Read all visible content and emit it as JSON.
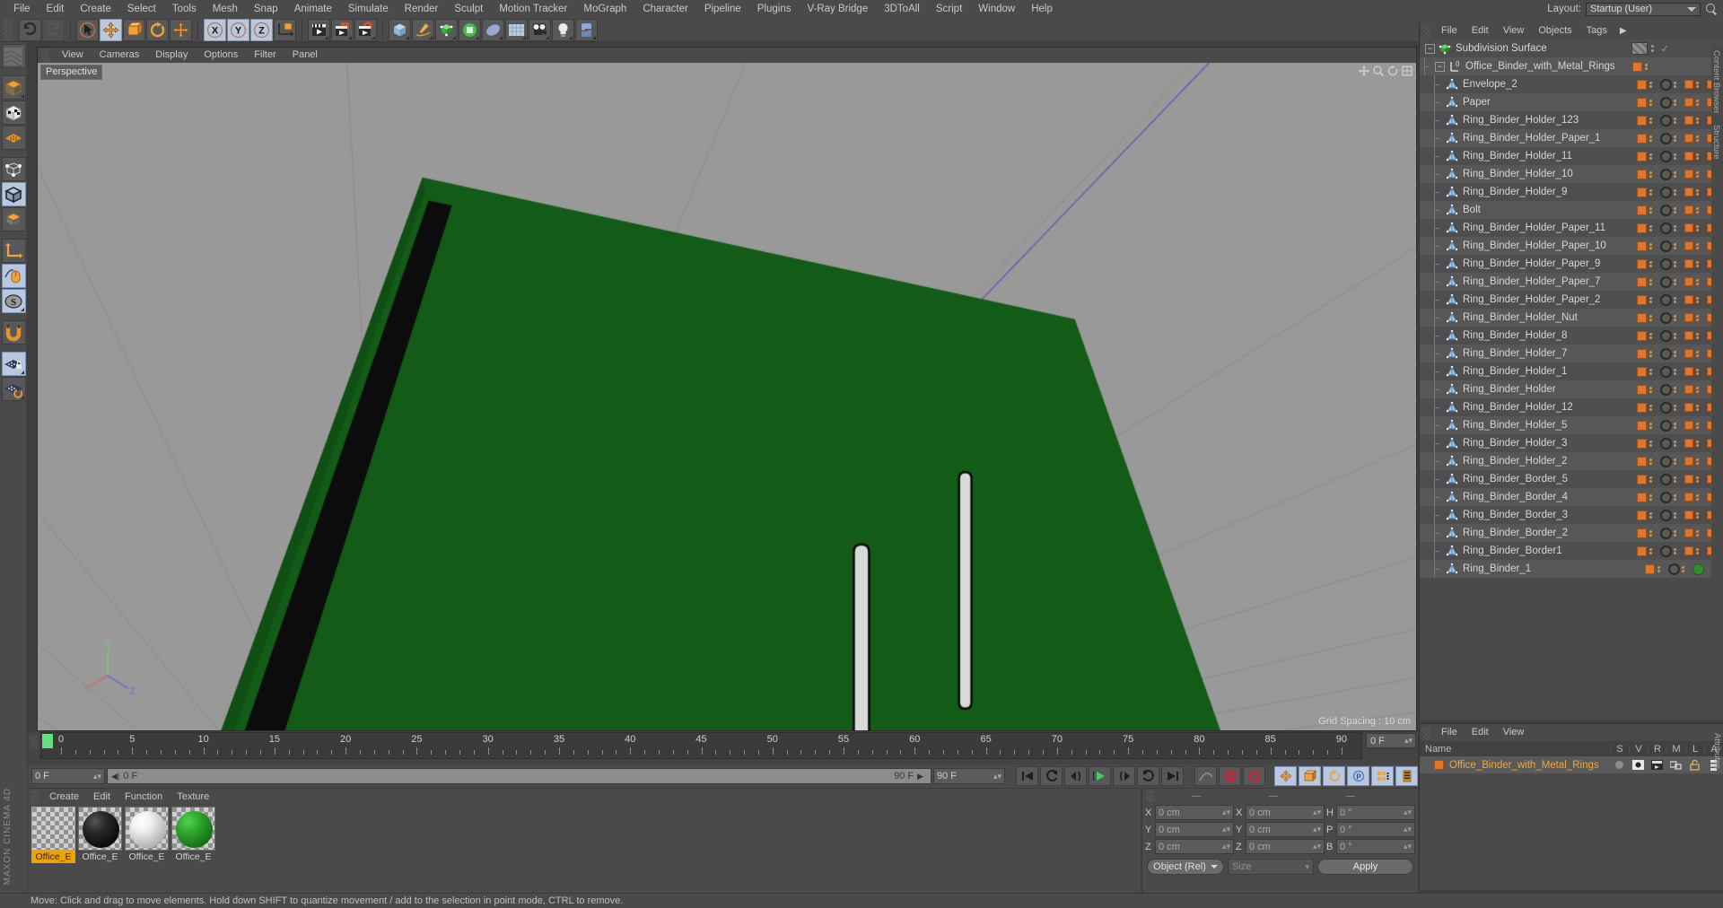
{
  "app": {
    "brand": "MAXON CINEMA 4D"
  },
  "menubar": {
    "items": [
      "File",
      "Edit",
      "Create",
      "Select",
      "Tools",
      "Mesh",
      "Snap",
      "Animate",
      "Simulate",
      "Render",
      "Sculpt",
      "Motion Tracker",
      "MoGraph",
      "Character",
      "Pipeline",
      "Plugins",
      "V-Ray Bridge",
      "3DToAll",
      "Script",
      "Window",
      "Help"
    ],
    "layout_label": "Layout:",
    "layout_value": "Startup (User)"
  },
  "viewport": {
    "menu": [
      "View",
      "Cameras",
      "Display",
      "Options",
      "Filter",
      "Panel"
    ],
    "camera_label": "Perspective",
    "grid_spacing": "Grid Spacing : 10 cm"
  },
  "object_manager": {
    "menu": [
      "File",
      "Edit",
      "View",
      "Objects",
      "Tags"
    ],
    "more": "▶",
    "items": [
      {
        "name": "Subdivision Surface",
        "depth": 0,
        "type": "generator"
      },
      {
        "name": "Office_Binder_with_Metal_Rings",
        "depth": 1,
        "type": "null"
      },
      {
        "name": "Envelope_2",
        "depth": 2,
        "type": "polygon"
      },
      {
        "name": "Paper",
        "depth": 2,
        "type": "polygon"
      },
      {
        "name": "Ring_Binder_Holder_123",
        "depth": 2,
        "type": "polygon"
      },
      {
        "name": "Ring_Binder_Holder_Paper_1",
        "depth": 2,
        "type": "polygon"
      },
      {
        "name": "Ring_Binder_Holder_11",
        "depth": 2,
        "type": "polygon"
      },
      {
        "name": "Ring_Binder_Holder_10",
        "depth": 2,
        "type": "polygon"
      },
      {
        "name": "Ring_Binder_Holder_9",
        "depth": 2,
        "type": "polygon"
      },
      {
        "name": "Bolt",
        "depth": 2,
        "type": "polygon"
      },
      {
        "name": "Ring_Binder_Holder_Paper_11",
        "depth": 2,
        "type": "polygon"
      },
      {
        "name": "Ring_Binder_Holder_Paper_10",
        "depth": 2,
        "type": "polygon"
      },
      {
        "name": "Ring_Binder_Holder_Paper_9",
        "depth": 2,
        "type": "polygon"
      },
      {
        "name": "Ring_Binder_Holder_Paper_7",
        "depth": 2,
        "type": "polygon"
      },
      {
        "name": "Ring_Binder_Holder_Paper_2",
        "depth": 2,
        "type": "polygon"
      },
      {
        "name": "Ring_Binder_Holder_Nut",
        "depth": 2,
        "type": "polygon"
      },
      {
        "name": "Ring_Binder_Holder_8",
        "depth": 2,
        "type": "polygon"
      },
      {
        "name": "Ring_Binder_Holder_7",
        "depth": 2,
        "type": "polygon"
      },
      {
        "name": "Ring_Binder_Holder_1",
        "depth": 2,
        "type": "polygon"
      },
      {
        "name": "Ring_Binder_Holder",
        "depth": 2,
        "type": "polygon"
      },
      {
        "name": "Ring_Binder_Holder_12",
        "depth": 2,
        "type": "polygon"
      },
      {
        "name": "Ring_Binder_Holder_5",
        "depth": 2,
        "type": "polygon"
      },
      {
        "name": "Ring_Binder_Holder_3",
        "depth": 2,
        "type": "polygon"
      },
      {
        "name": "Ring_Binder_Holder_2",
        "depth": 2,
        "type": "polygon"
      },
      {
        "name": "Ring_Binder_Border_5",
        "depth": 2,
        "type": "polygon"
      },
      {
        "name": "Ring_Binder_Border_4",
        "depth": 2,
        "type": "polygon"
      },
      {
        "name": "Ring_Binder_Border_3",
        "depth": 2,
        "type": "polygon"
      },
      {
        "name": "Ring_Binder_Border_2",
        "depth": 2,
        "type": "polygon"
      },
      {
        "name": "Ring_Binder_Border1",
        "depth": 2,
        "type": "polygon"
      },
      {
        "name": "Ring_Binder_1",
        "depth": 2,
        "type": "polygon"
      }
    ],
    "side_tabs": [
      "Content Browser",
      "Structure"
    ]
  },
  "layer_manager": {
    "menu": [
      "File",
      "Edit",
      "View"
    ],
    "columns": [
      "Name",
      "S",
      "V",
      "R",
      "M",
      "L",
      "A"
    ],
    "rows": [
      {
        "name": "Office_Binder_with_Metal_Rings"
      }
    ],
    "side_tab": "Attributes"
  },
  "timeline": {
    "ticks": [
      0,
      5,
      10,
      15,
      20,
      25,
      30,
      35,
      40,
      45,
      50,
      55,
      60,
      65,
      70,
      75,
      80,
      85,
      90
    ],
    "current_frame_box": "0 F",
    "start_field": "0 F",
    "strip_value": "0 F",
    "strip_end": "90 F",
    "end_field": "90 F",
    "end_box": "0 F"
  },
  "material_manager": {
    "menu": [
      "Create",
      "Edit",
      "Function",
      "Texture"
    ],
    "materials": [
      {
        "name": "Office_E",
        "color": "transparent",
        "selected": true
      },
      {
        "name": "Office_E",
        "color": "#111111",
        "selected": false
      },
      {
        "name": "Office_E",
        "color": "#e8e8e8",
        "selected": false
      },
      {
        "name": "Office_E",
        "color": "#1f8a22",
        "selected": false
      }
    ]
  },
  "coordinates": {
    "headers": [
      "—",
      "—",
      "—"
    ],
    "position": {
      "x_label": "X",
      "x": "0 cm",
      "y_label": "Y",
      "y": "0 cm",
      "z_label": "Z",
      "z": "0 cm"
    },
    "size": {
      "x_label": "X",
      "x": "0 cm",
      "y_label": "Y",
      "y": "0 cm",
      "z_label": "Z",
      "z": "0 cm"
    },
    "rotation": {
      "h_label": "H",
      "h": "0 °",
      "p_label": "P",
      "p": "0 °",
      "b_label": "B",
      "b": "0 °"
    },
    "mode": "Object (Rel)",
    "size_field": "Size",
    "apply": "Apply"
  },
  "statusbar": {
    "text": "Move: Click and drag to move elements. Hold down SHIFT to quantize movement / add to the selection in point mode, CTRL to remove."
  },
  "colors": {
    "chrome": "#4a4a4a",
    "panel": "#575757",
    "accent_orange": "#e2752a",
    "selected_blue": "#b8c8e0",
    "binder_green": "#1f8a22",
    "text": "#c8c8c8"
  }
}
